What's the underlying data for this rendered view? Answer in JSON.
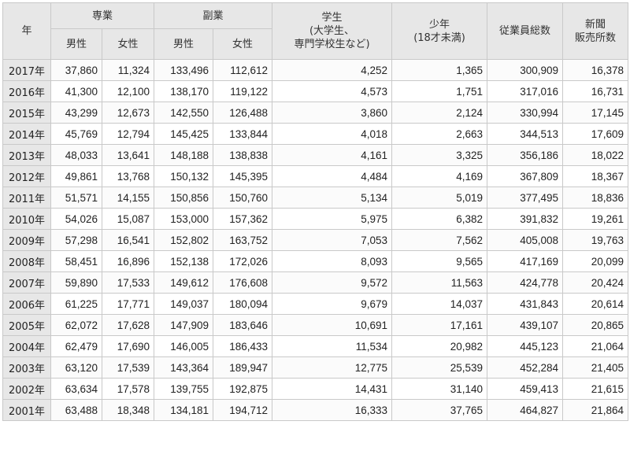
{
  "headers": {
    "year": "年",
    "main": "専業",
    "side": "副業",
    "male": "男性",
    "female": "女性",
    "student_line1": "学生",
    "student_line2": "(大学生、",
    "student_line3": "専門学校生など)",
    "youth_line1": "少年",
    "youth_line2": "(18才未満)",
    "total": "従業員総数",
    "stores_line1": "新聞",
    "stores_line2": "販売所数"
  },
  "rows": [
    [
      "2017年",
      "37,860",
      "11,324",
      "133,496",
      "112,612",
      "4,252",
      "1,365",
      "300,909",
      "16,378"
    ],
    [
      "2016年",
      "41,300",
      "12,100",
      "138,170",
      "119,122",
      "4,573",
      "1,751",
      "317,016",
      "16,731"
    ],
    [
      "2015年",
      "43,299",
      "12,673",
      "142,550",
      "126,488",
      "3,860",
      "2,124",
      "330,994",
      "17,145"
    ],
    [
      "2014年",
      "45,769",
      "12,794",
      "145,425",
      "133,844",
      "4,018",
      "2,663",
      "344,513",
      "17,609"
    ],
    [
      "2013年",
      "48,033",
      "13,641",
      "148,188",
      "138,838",
      "4,161",
      "3,325",
      "356,186",
      "18,022"
    ],
    [
      "2012年",
      "49,861",
      "13,768",
      "150,132",
      "145,395",
      "4,484",
      "4,169",
      "367,809",
      "18,367"
    ],
    [
      "2011年",
      "51,571",
      "14,155",
      "150,856",
      "150,760",
      "5,134",
      "5,019",
      "377,495",
      "18,836"
    ],
    [
      "2010年",
      "54,026",
      "15,087",
      "153,000",
      "157,362",
      "5,975",
      "6,382",
      "391,832",
      "19,261"
    ],
    [
      "2009年",
      "57,298",
      "16,541",
      "152,802",
      "163,752",
      "7,053",
      "7,562",
      "405,008",
      "19,763"
    ],
    [
      "2008年",
      "58,451",
      "16,896",
      "152,138",
      "172,026",
      "8,093",
      "9,565",
      "417,169",
      "20,099"
    ],
    [
      "2007年",
      "59,890",
      "17,533",
      "149,612",
      "176,608",
      "9,572",
      "11,563",
      "424,778",
      "20,424"
    ],
    [
      "2006年",
      "61,225",
      "17,771",
      "149,037",
      "180,094",
      "9,679",
      "14,037",
      "431,843",
      "20,614"
    ],
    [
      "2005年",
      "62,072",
      "17,628",
      "147,909",
      "183,646",
      "10,691",
      "17,161",
      "439,107",
      "20,865"
    ],
    [
      "2004年",
      "62,479",
      "17,690",
      "146,005",
      "186,433",
      "11,534",
      "20,982",
      "445,123",
      "21,064"
    ],
    [
      "2003年",
      "63,120",
      "17,539",
      "143,364",
      "189,947",
      "12,775",
      "25,539",
      "452,284",
      "21,405"
    ],
    [
      "2002年",
      "63,634",
      "17,578",
      "139,755",
      "192,875",
      "14,431",
      "31,140",
      "459,413",
      "21,615"
    ],
    [
      "2001年",
      "63,488",
      "18,348",
      "134,181",
      "194,712",
      "16,333",
      "37,765",
      "464,827",
      "21,864"
    ]
  ]
}
